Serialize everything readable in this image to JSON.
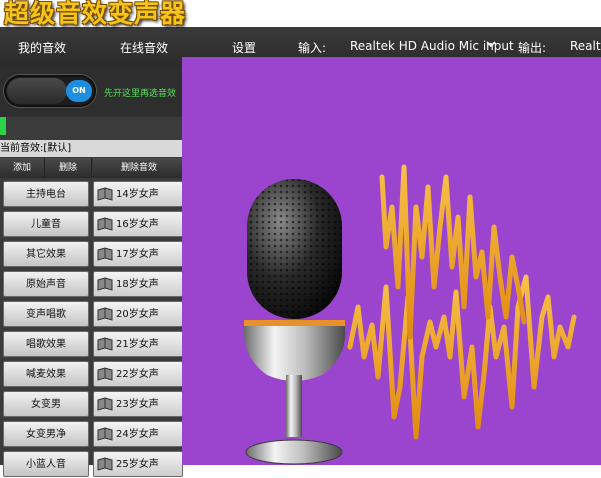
{
  "app": {
    "title": "超级音效变声器"
  },
  "nav": {
    "my_effects": "我的音效",
    "online_effects": "在线音效",
    "settings": "设置",
    "input_label": "输入:",
    "input_device": "Realtek HD Audio Mic input",
    "output_label": "输出:",
    "output_device": "Realte"
  },
  "toggle": {
    "state_label": "ON",
    "hint": "先开这里再选音效"
  },
  "current_effect": "当前音效:[默认]",
  "columns": {
    "add": "添加",
    "delete": "删除",
    "delete_effect": "删除音效"
  },
  "categories": [
    "主持电台",
    "儿童音",
    "其它效果",
    "原始声音",
    "变声唱歌",
    "唱歌效果",
    "喊麦效果",
    "女变男",
    "女变男净",
    "小蓝人音"
  ],
  "effects": [
    "14岁女声",
    "16岁女声",
    "17岁女声",
    "18岁女声",
    "20岁女声",
    "21岁女声",
    "22岁女声",
    "23岁女声",
    "24岁女声",
    "25岁女声"
  ],
  "colors": {
    "art_background": "#9b45cf",
    "waveform": "#f2a21c",
    "toggle_on": "#1e8fe0",
    "hint_text": "#58e05a"
  },
  "icons": {
    "effect_item": "book-icon",
    "dropdown": "chevron-down-icon",
    "illustration": "microphone-icon"
  }
}
